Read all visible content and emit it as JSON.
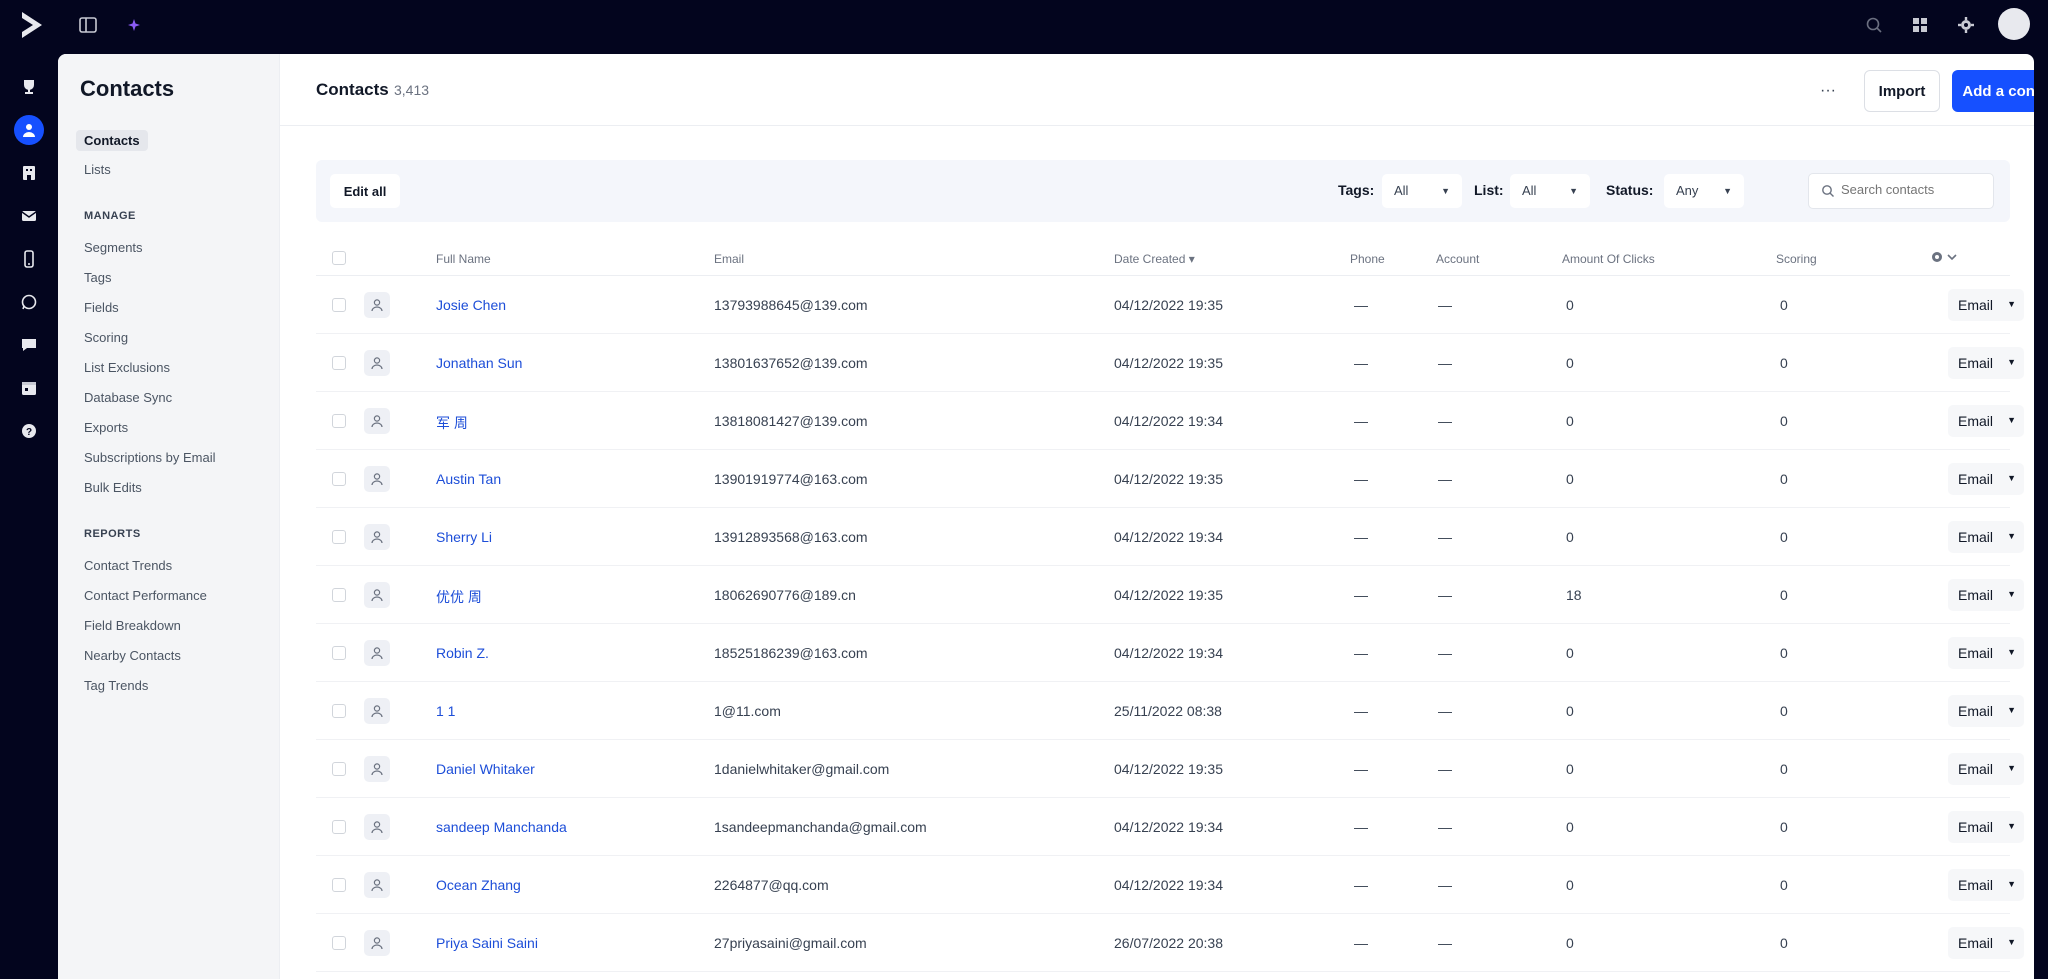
{
  "topbar": {
    "icons": [
      "logo-icon",
      "sidebar-toggle-icon",
      "sparkle-icon",
      "search-icon",
      "grid-icon",
      "settings-icon",
      "user-avatar"
    ]
  },
  "rail": {
    "icons": [
      "trophy-icon",
      "contacts-icon",
      "building-icon",
      "mail-icon",
      "mobile-icon",
      "whatsapp-icon",
      "chat-icon",
      "calendar-icon",
      "help-icon"
    ],
    "active": "contacts-icon"
  },
  "sidebar": {
    "title": "Contacts",
    "items": [
      "Contacts",
      "Lists"
    ],
    "sections": [
      {
        "label": "MANAGE",
        "items": [
          "Segments",
          "Tags",
          "Fields",
          "Scoring",
          "List Exclusions",
          "Database Sync",
          "Exports",
          "Subscriptions by Email",
          "Bulk Edits"
        ]
      },
      {
        "label": "REPORTS",
        "items": [
          "Contact Trends",
          "Contact Performance",
          "Field Breakdown",
          "Nearby Contacts",
          "Tag Trends"
        ]
      }
    ]
  },
  "header": {
    "title": "Contacts",
    "count": "3,413",
    "more_label": "···",
    "import_label": "Import",
    "add_label": "Add a contact"
  },
  "filters": {
    "edit_all": "Edit all",
    "tags_label": "Tags:",
    "tags_value": "All",
    "list_label": "List:",
    "list_value": "All",
    "status_label": "Status:",
    "status_value": "Any",
    "search_placeholder": "Search contacts"
  },
  "table": {
    "columns": [
      "Full Name",
      "Email",
      "Date Created",
      "Phone",
      "Account",
      "Amount Of Clicks",
      "Scoring"
    ],
    "sort_indicator": "▾",
    "action_label": "Email",
    "rows": [
      {
        "name": "Josie Chen",
        "email": "13793988645@139.com",
        "date": "04/12/2022 19:35",
        "phone": "—",
        "account": "—",
        "clicks": "0",
        "scoring": "0"
      },
      {
        "name": "Jonathan Sun",
        "email": "13801637652@139.com",
        "date": "04/12/2022 19:35",
        "phone": "—",
        "account": "—",
        "clicks": "0",
        "scoring": "0"
      },
      {
        "name": "军 周",
        "email": "13818081427@139.com",
        "date": "04/12/2022 19:34",
        "phone": "—",
        "account": "—",
        "clicks": "0",
        "scoring": "0"
      },
      {
        "name": "Austin Tan",
        "email": "13901919774@163.com",
        "date": "04/12/2022 19:35",
        "phone": "—",
        "account": "—",
        "clicks": "0",
        "scoring": "0"
      },
      {
        "name": "Sherry Li",
        "email": "13912893568@163.com",
        "date": "04/12/2022 19:34",
        "phone": "—",
        "account": "—",
        "clicks": "0",
        "scoring": "0"
      },
      {
        "name": "优优 周",
        "email": "18062690776@189.cn",
        "date": "04/12/2022 19:35",
        "phone": "—",
        "account": "—",
        "clicks": "18",
        "scoring": "0"
      },
      {
        "name": "Robin Z.",
        "email": "18525186239@163.com",
        "date": "04/12/2022 19:34",
        "phone": "—",
        "account": "—",
        "clicks": "0",
        "scoring": "0"
      },
      {
        "name": "1 1",
        "email": "1@11.com",
        "date": "25/11/2022 08:38",
        "phone": "—",
        "account": "—",
        "clicks": "0",
        "scoring": "0"
      },
      {
        "name": "Daniel Whitaker",
        "email": "1danielwhitaker@gmail.com",
        "date": "04/12/2022 19:35",
        "phone": "—",
        "account": "—",
        "clicks": "0",
        "scoring": "0"
      },
      {
        "name": "sandeep Manchanda",
        "email": "1sandeepmanchanda@gmail.com",
        "date": "04/12/2022 19:34",
        "phone": "—",
        "account": "—",
        "clicks": "0",
        "scoring": "0"
      },
      {
        "name": "Ocean Zhang",
        "email": "2264877@qq.com",
        "date": "04/12/2022 19:34",
        "phone": "—",
        "account": "—",
        "clicks": "0",
        "scoring": "0"
      },
      {
        "name": "Priya Saini Saini",
        "email": "27priyasaini@gmail.com",
        "date": "26/07/2022 20:38",
        "phone": "—",
        "account": "—",
        "clicks": "0",
        "scoring": "0"
      }
    ]
  }
}
